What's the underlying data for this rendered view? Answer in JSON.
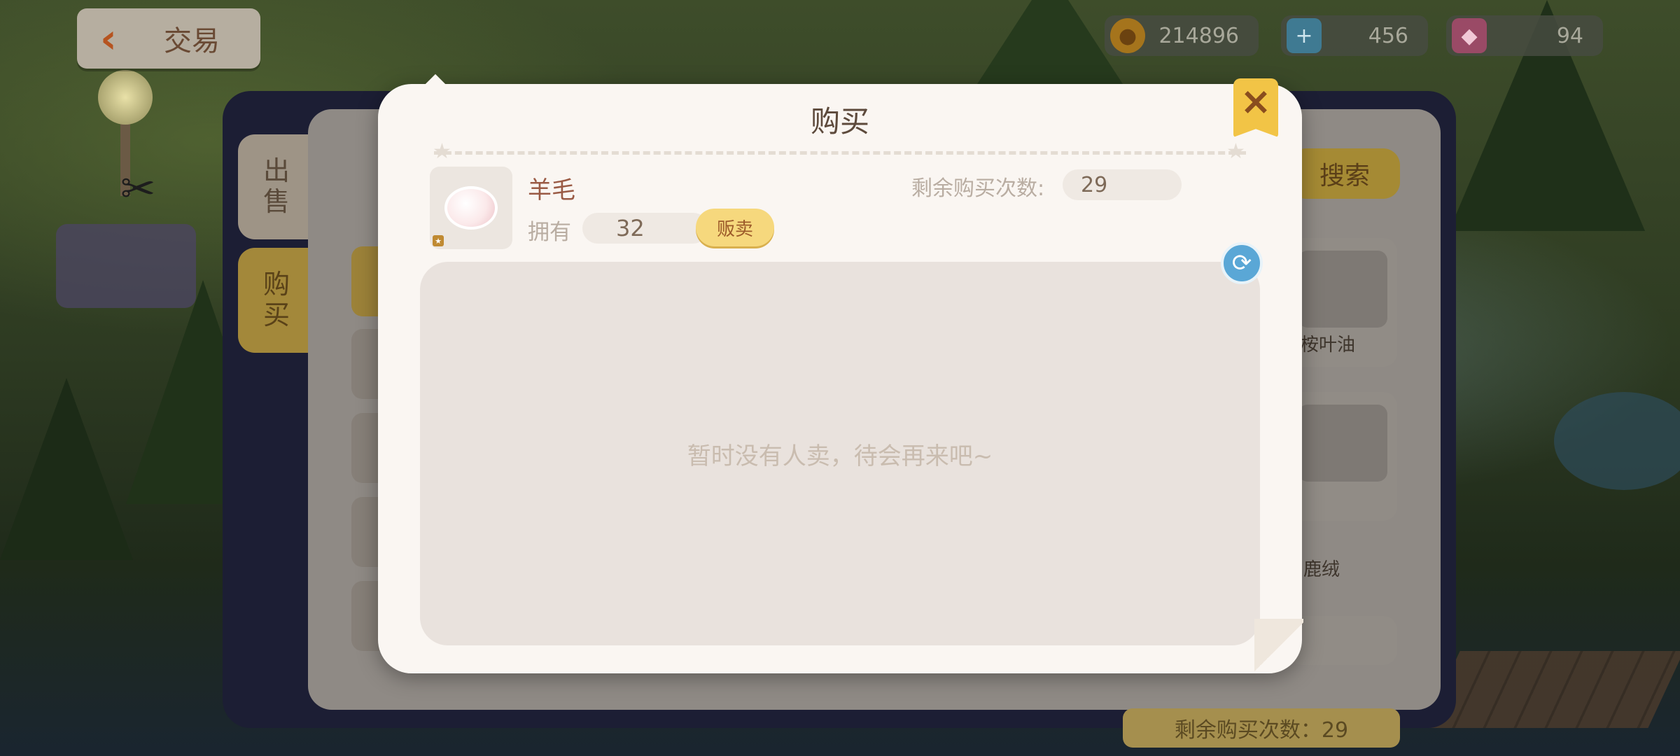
{
  "header": {
    "back_label": "交易"
  },
  "resources": {
    "coins": "214896",
    "energy": "456",
    "gems": "94"
  },
  "trade": {
    "tabs": [
      {
        "label": "出\n售"
      },
      {
        "label": "购\n买"
      }
    ],
    "search_label": "搜索",
    "cards": [
      {
        "label": "桉叶油"
      },
      {
        "label": "鹿绒"
      }
    ],
    "remaining_label": "剩余购买次数：29"
  },
  "modal": {
    "title": "购买",
    "close_icon": "close-icon",
    "item": {
      "name": "羊毛",
      "own_label": "拥有",
      "own_count": "32",
      "sell_label": "贩卖"
    },
    "remaining_label": "剩余购买次数:",
    "remaining_count": "29",
    "refresh_icon": "refresh-icon",
    "empty_message": "暂时没有人卖，待会再来吧~"
  },
  "colors": {
    "accent_yellow": "#f6d87d",
    "modal_bg": "#faf6f2",
    "title_brown": "#5d4a3c",
    "refresh_blue": "#5aa7d6"
  }
}
